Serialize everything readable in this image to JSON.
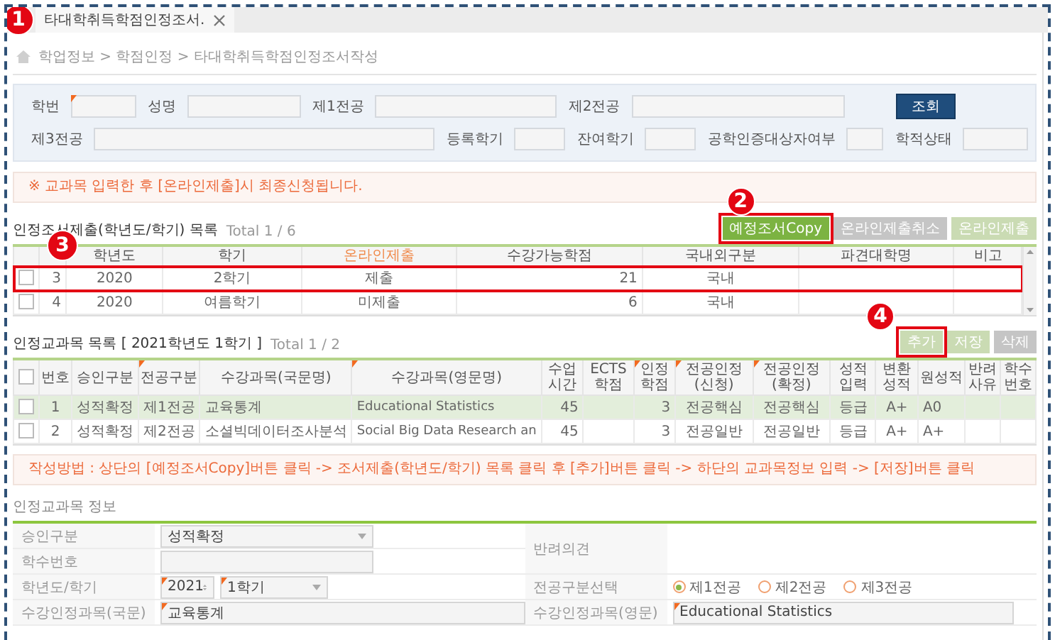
{
  "tab": {
    "title": "타대학취득학점인정조서.",
    "marker": "1"
  },
  "breadcrumb": "학업정보 > 학점인정 > 타대학취득학점인정조서작성",
  "search": {
    "fields": [
      {
        "label": "학번",
        "required": true
      },
      {
        "label": "성명",
        "required": false
      },
      {
        "label": "제1전공",
        "required": false
      },
      {
        "label": "제2전공",
        "required": false
      },
      {
        "label": "제3전공",
        "required": false
      },
      {
        "label": "등록학기",
        "required": false
      },
      {
        "label": "잔여학기",
        "required": false
      },
      {
        "label": "공학인증대상자여부",
        "required": false
      },
      {
        "label": "학적상태",
        "required": false
      }
    ],
    "button": "조회"
  },
  "notice": "※ 교과목 입력한 후 [온라인제출]시 최종신청됩니다.",
  "submissions": {
    "title": "인정조서제출(학년도/학기) 목록",
    "total": "Total 1 / 6",
    "buttons": [
      {
        "label": "예정조서Copy",
        "kind": "active",
        "marker": "2",
        "highlighted": true
      },
      {
        "label": "온라인제출취소",
        "kind": "gray",
        "highlighted": false
      },
      {
        "label": "온라인제출",
        "kind": "pale",
        "highlighted": false
      }
    ],
    "columns": [
      null,
      {
        "label": "학년도",
        "emphasis": false
      },
      {
        "label": "학기",
        "emphasis": false
      },
      {
        "label": "온라인제출",
        "emphasis": true
      },
      {
        "label": "수강가능학점",
        "emphasis": false
      },
      {
        "label": "국내외구분",
        "emphasis": false
      },
      {
        "label": "파견대학명",
        "emphasis": false
      },
      {
        "label": "비고",
        "emphasis": false
      }
    ],
    "rows": [
      {
        "checked": false,
        "highlighted": true,
        "marker": "3",
        "cells": [
          "3",
          "2020",
          "2학기",
          "제출",
          "21",
          "국내",
          null,
          null
        ]
      },
      {
        "checked": false,
        "highlighted": false,
        "cells": [
          "4",
          "2020",
          "여름학기",
          "미제출",
          "6",
          "국내",
          null,
          null
        ]
      }
    ]
  },
  "courses": {
    "title": "인정교과목 목록 [ 2021학년도 1학기 ]",
    "total": "Total 1 / 2",
    "buttons": [
      {
        "label": "추가",
        "kind": "pale",
        "marker": "4",
        "highlighted": true
      },
      {
        "label": "저장",
        "kind": "pale",
        "highlighted": false
      },
      {
        "label": "삭제",
        "kind": "gray",
        "highlighted": false
      }
    ],
    "all_checked": false,
    "columns": [
      {
        "label": "번호",
        "required": false
      },
      {
        "label": "승인구분",
        "required": false
      },
      {
        "label": "전공구분",
        "required": true
      },
      {
        "label": "수강과목(국문명)",
        "required": false
      },
      {
        "label": "수강과목(영문명)",
        "required": true
      },
      {
        "label": "수업 시간",
        "required": false
      },
      {
        "label": "ECTS 학점",
        "required": false
      },
      {
        "label": "인정 학점",
        "required": true
      },
      {
        "label": "전공인정 (신청)",
        "required": true
      },
      {
        "label": "전공인정 (확정)",
        "required": true
      },
      {
        "label": "성적 입력",
        "required": false
      },
      {
        "label": "변환 성적",
        "required": false
      },
      {
        "label": "원성적",
        "required": false
      },
      {
        "label": "반려사유",
        "required": false
      },
      {
        "label": "학수번호",
        "required": false
      }
    ],
    "rows": [
      {
        "checked": false,
        "selected": true,
        "cells": [
          "1",
          "성적확정",
          "제1전공",
          "교육통계",
          "Educational Statistics",
          "45",
          null,
          "3",
          "전공핵심",
          "전공핵심",
          "등급",
          "A+",
          "A0",
          null,
          null
        ]
      },
      {
        "checked": false,
        "selected": false,
        "cells": [
          "2",
          "성적확정",
          "제2전공",
          "소셜빅데이터조사분석",
          "Social Big Data Research an",
          "45",
          null,
          "3",
          "전공일반",
          "전공일반",
          "등급",
          "A+",
          "A+",
          null,
          null
        ]
      }
    ]
  },
  "instructions": "작성방법 : 상단의 [예정조서Copy]버튼 클릭 -> 조서제출(학년도/학기) 목록 클릭 후 [추가]버튼 클릭 -> 하단의 교과목정보 입력 -> [저장]버튼 클릭",
  "detail": {
    "title": "인정교과목 정보",
    "left": [
      {
        "label": "승인구분",
        "kind": "select",
        "value": "성적확정",
        "required": false
      },
      {
        "label": "학수번호",
        "kind": "text",
        "required": false
      },
      {
        "label": "학년도/학기",
        "kind": "yearterm",
        "year": "2021",
        "term": "1학기",
        "required": true
      },
      {
        "label": "수강인정과목(국문)",
        "kind": "text",
        "value": "교육통계",
        "required": true
      }
    ],
    "right": [
      {
        "label": "반려의견",
        "kind": "blank"
      },
      {
        "label": "전공구분선택",
        "kind": "radio",
        "options": [
          {
            "label": "제1전공",
            "selected": true
          },
          {
            "label": "제2전공",
            "selected": false
          },
          {
            "label": "제3전공",
            "selected": false
          }
        ]
      },
      {
        "label": "수강인정과목(영문)",
        "kind": "text",
        "value": "Educational Statistics",
        "required": true
      }
    ]
  }
}
